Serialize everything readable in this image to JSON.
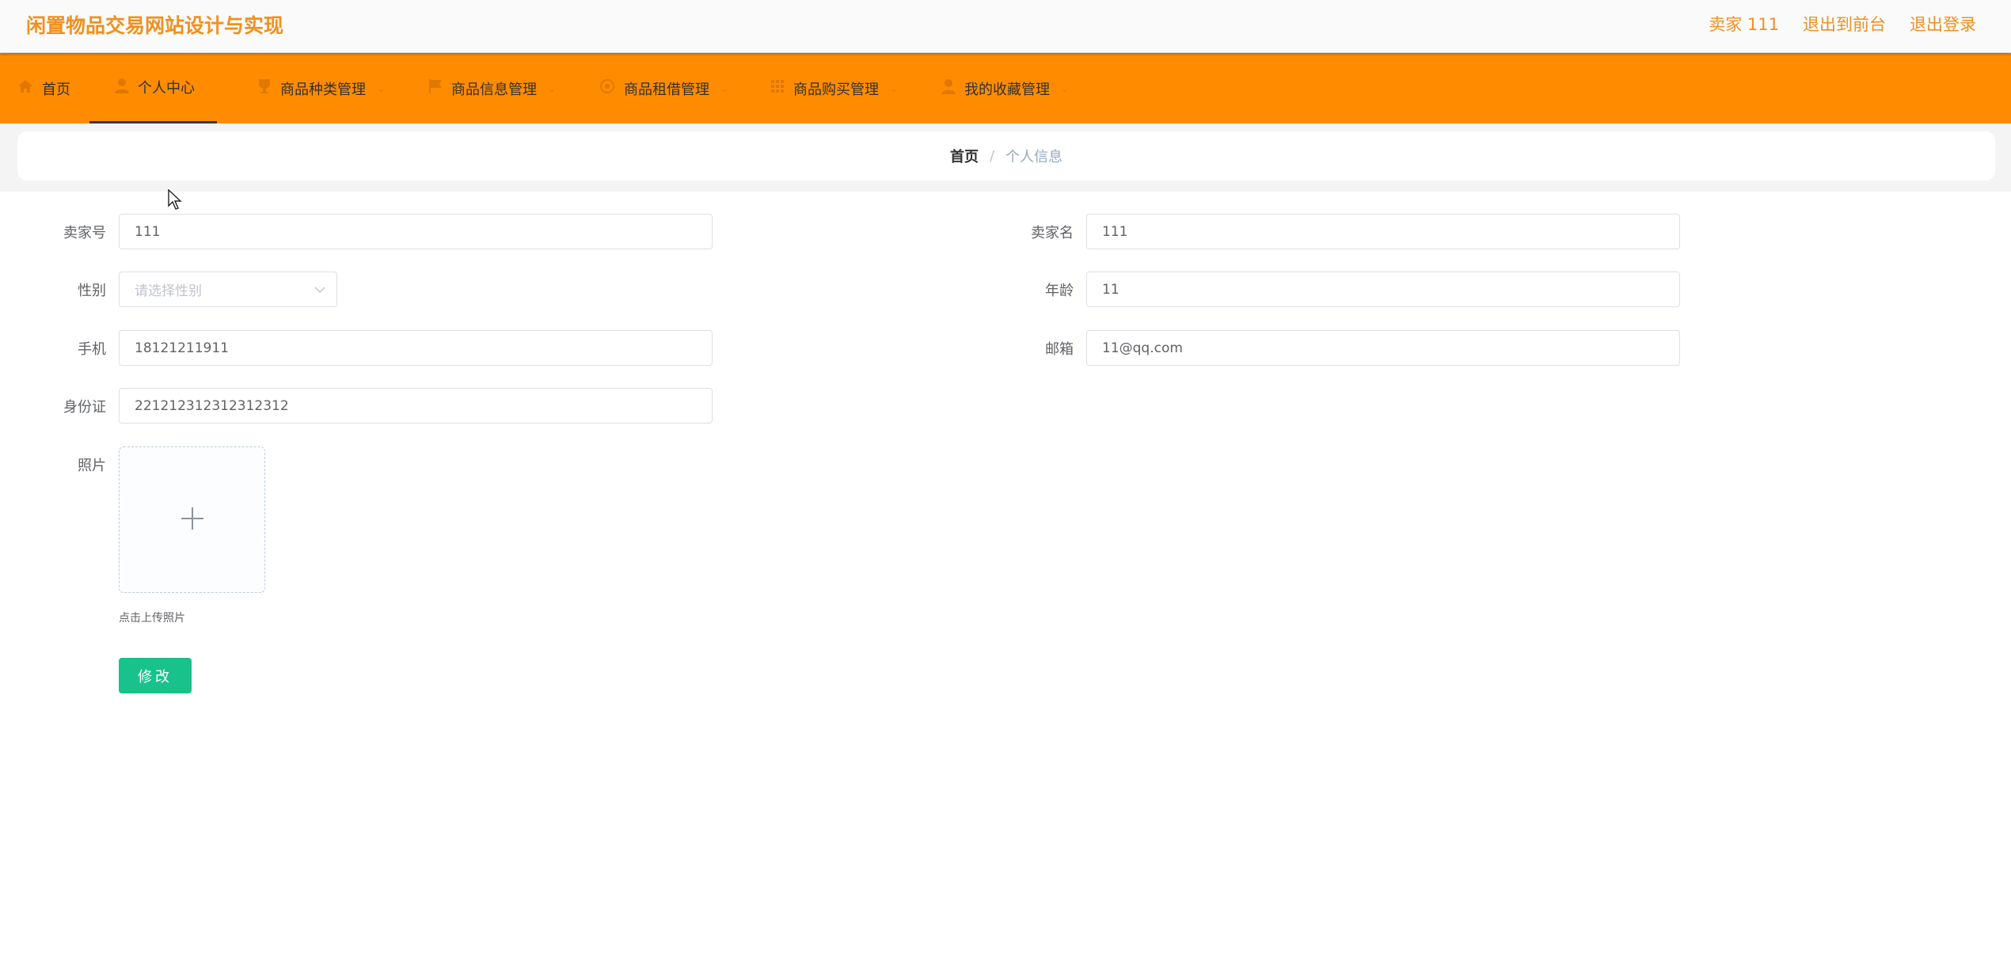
{
  "header": {
    "title": "闲置物品交易网站设计与实现",
    "links": [
      "卖家 111",
      "退出到前台",
      "退出登录"
    ]
  },
  "nav": {
    "items": [
      {
        "label": "首页",
        "icon": "home-icon"
      },
      {
        "label": "个人中心",
        "icon": "user-icon"
      },
      {
        "label": "商品种类管理",
        "icon": "trophy-icon"
      },
      {
        "label": "商品信息管理",
        "icon": "flag-icon"
      },
      {
        "label": "商品租借管理",
        "icon": "circle-icon"
      },
      {
        "label": "商品购买管理",
        "icon": "grid-icon"
      },
      {
        "label": "我的收藏管理",
        "icon": "user-icon"
      }
    ]
  },
  "breadcrumb": {
    "home": "首页",
    "separator": "/",
    "current": "个人信息"
  },
  "form": {
    "seller_no": {
      "label": "卖家号",
      "value": "111"
    },
    "seller_name": {
      "label": "卖家名",
      "value": "111"
    },
    "gender": {
      "label": "性别",
      "placeholder": "请选择性别"
    },
    "age": {
      "label": "年龄",
      "value": "11"
    },
    "phone": {
      "label": "手机",
      "value": "18121211911"
    },
    "email": {
      "label": "邮箱",
      "value": "11@qq.com"
    },
    "id_card": {
      "label": "身份证",
      "value": "221212312312312312"
    },
    "photo": {
      "label": "照片",
      "tip": "点击上传照片"
    },
    "submit_label": "修改"
  },
  "colors": {
    "header_text": "#f0901e",
    "nav_bg": "#ff8c00",
    "button": "#19c28a"
  }
}
